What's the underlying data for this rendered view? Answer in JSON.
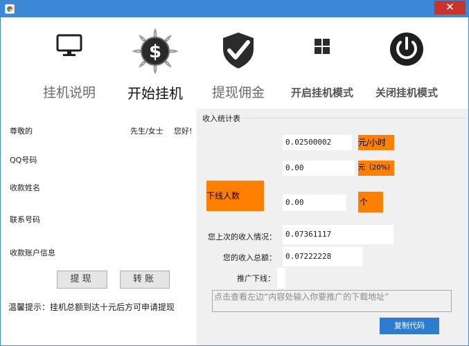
{
  "window": {
    "close_glyph": "✕",
    "app_icon": "app-icon"
  },
  "toolbar": {
    "items": [
      {
        "label": "挂机说明",
        "icon": "monitor-icon"
      },
      {
        "label": "开始挂机",
        "icon": "dollar-coin-icon"
      },
      {
        "label": "提现佣金",
        "icon": "shield-check-icon"
      },
      {
        "label": "开启挂机模式",
        "icon": "windows-icon"
      },
      {
        "label": "关闭挂机模式",
        "icon": "power-icon"
      }
    ]
  },
  "left": {
    "greeting": "尊敬的",
    "salutation": "先生/女士",
    "hello": "您好!",
    "qq": "QQ号码",
    "payee_name": "收款姓名",
    "phone": "联系号码",
    "account": "收款账户信息",
    "withdraw_button": "提现",
    "transfer_button": "转账",
    "tip": "温馨提示：挂机总额到达十元后方可申请提现"
  },
  "right": {
    "group_title": "收入统计表",
    "rate_value": "0.02500002",
    "rate_unit": "元/小时",
    "commission_value": "0.00",
    "commission_unit": "元（20%)",
    "downline_label": "下线人数",
    "downline_value": "0.00",
    "downline_unit": "个",
    "last_income_label": "您上次的收入情况：",
    "last_income_value": "0.07361117",
    "total_income_label": "您的收入总额：",
    "total_income_value": "0.07222228",
    "promo_label": "推广下线：",
    "promo_placeholder": "点击查看左边“内容处输入你要推广的下载地址”",
    "copy_button": "复制代码"
  },
  "colors": {
    "accent": "#3c88d6",
    "orange": "#ff8000",
    "close": "#c7342b",
    "button_blue": "#2f7bd0"
  }
}
